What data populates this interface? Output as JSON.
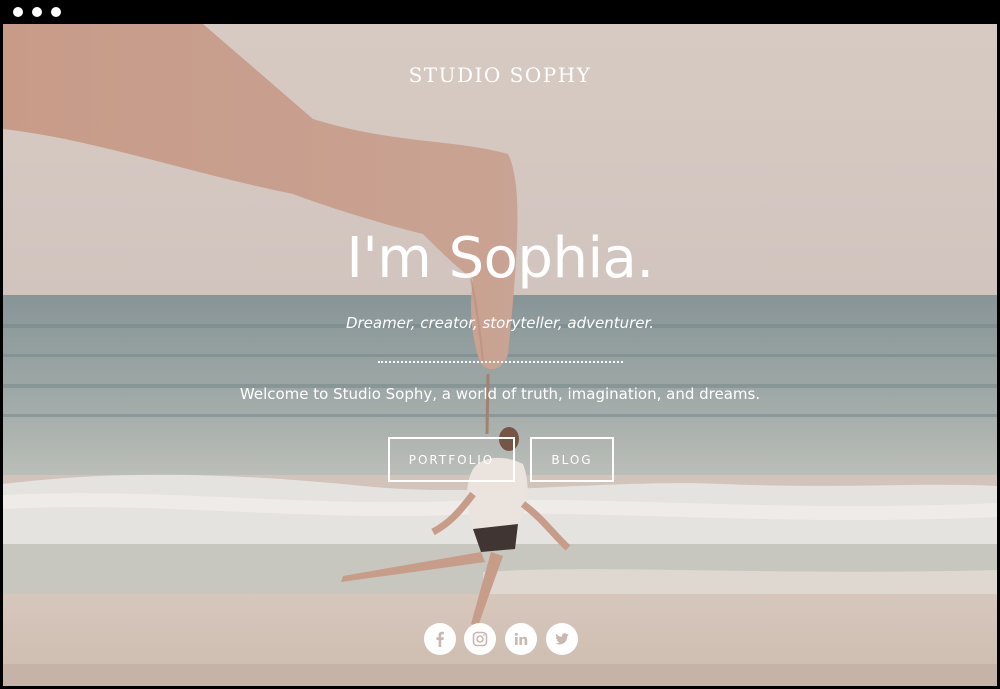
{
  "brand": {
    "name": "STUDIO SOPHY"
  },
  "hero": {
    "title": "I'm Sophia.",
    "tagline": "Dreamer, creator, storyteller, adventurer.",
    "welcome": "Welcome to Studio Sophy, a world of truth, imagination, and dreams."
  },
  "buttons": {
    "portfolio": "PORTFOLIO",
    "blog": "BLOG"
  },
  "social": {
    "icons": [
      "facebook-icon",
      "instagram-icon",
      "linkedin-icon",
      "twitter-icon"
    ],
    "icon_color": "#c9b8b0"
  },
  "colors": {
    "text": "#ffffff",
    "sky": "#d7cfc8",
    "sea": "#8fa4a6",
    "sand": "#e7d9cd"
  }
}
